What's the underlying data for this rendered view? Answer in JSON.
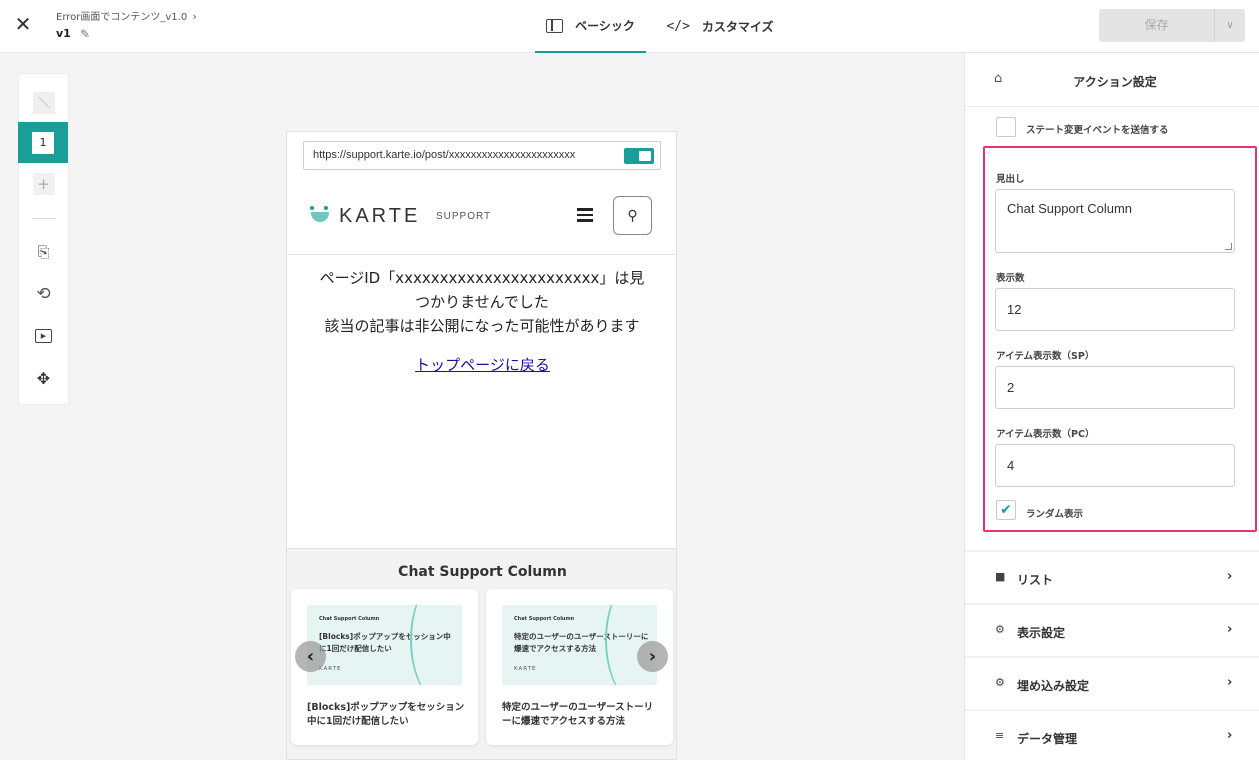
{
  "header": {
    "close_icon": "✕",
    "breadcrumb": "Error画面でコンテンツ_v1.0",
    "breadcrumb_chevron": "›",
    "version": "v1",
    "pencil_icon": "✎",
    "tabs": [
      {
        "label": "ベーシック",
        "icon": "layout-icon"
      },
      {
        "label": "カスタマイズ",
        "icon": "code-icon",
        "glyph": "</>"
      }
    ],
    "save_label": "保存",
    "save_dropdown": "∨"
  },
  "toolbar": {
    "page_number": "1",
    "add_glyph": "+",
    "device_glyph": "⎘",
    "rotate_glyph": "⟲",
    "play_glyph": "▶",
    "expand_glyph": "✥"
  },
  "preview": {
    "url": "https://support.karte.io/post/xxxxxxxxxxxxxxxxxxxxxxx",
    "logo_text": "KARTE",
    "logo_sub": "SUPPORT",
    "search_glyph": "⚲",
    "error_line1": "ページID「xxxxxxxxxxxxxxxxxxxxxxx」は見",
    "error_line2": "つかりませんでした",
    "error_line3": "該当の記事は非公開になった可能性があります",
    "back_link": "トップページに戻る",
    "column_title": "Chat Support Column",
    "cards": [
      {
        "thumb_small": "Chat Support Column",
        "thumb_title": "[Blocks]ポップアップをセッション中に1回だけ配信したい",
        "thumb_logo": "KARTE",
        "text": "[Blocks]ポップアップをセッション中に1回だけ配信したい"
      },
      {
        "thumb_small": "Chat Support Column",
        "thumb_title": "特定のユーザーのユーザーストーリーに爆速でアクセスする方法",
        "thumb_logo": "KARTE",
        "text": "特定のユーザーのユーザーストーリーに爆速でアクセスする方法"
      }
    ],
    "arrow_left": "‹",
    "arrow_right": "›"
  },
  "panel": {
    "home_glyph": "⌂",
    "title": "アクション設定",
    "state_checkbox_label": "ステート変更イベントを送信する",
    "heading_label": "見出し",
    "heading_value": "Chat Support Column",
    "count_label": "表示数",
    "count_value": "12",
    "sp_label": "アイテム表示数（SP）",
    "sp_value": "2",
    "pc_label": "アイテム表示数（PC）",
    "pc_value": "4",
    "random_label": "ランダム表示",
    "random_checked": true,
    "check_glyph": "✔",
    "sections": [
      {
        "label": "リスト",
        "icon": "folder-icon",
        "glyph": "■"
      },
      {
        "label": "表示設定",
        "icon": "gear-icon",
        "glyph": "⚙"
      },
      {
        "label": "埋め込み設定",
        "icon": "gear-icon",
        "glyph": "⚙"
      },
      {
        "label": "データ管理",
        "icon": "database-icon",
        "glyph": "≡"
      }
    ],
    "section_chevron": "›"
  },
  "colors": {
    "accent": "#1b9e9a",
    "highlight": "#e8336d",
    "link": "#1a0dab"
  }
}
